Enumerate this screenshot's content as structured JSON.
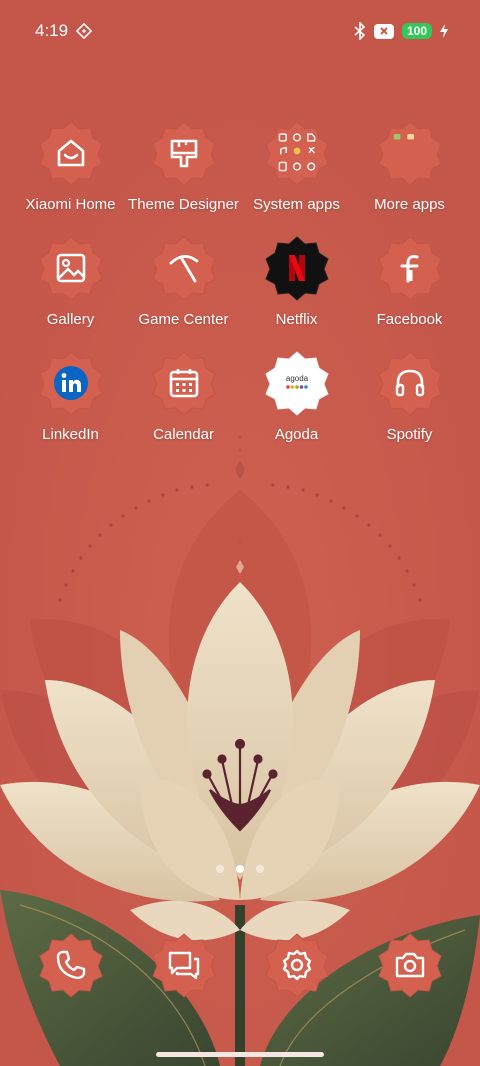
{
  "status_bar": {
    "time": "4:19",
    "battery": "100",
    "icons": [
      "sync-icon",
      "bluetooth-icon",
      "x-badge-icon",
      "charging-icon"
    ]
  },
  "apps": [
    {
      "label": "Xiaomi Home",
      "icon": "home-icon"
    },
    {
      "label": "Theme Designer",
      "icon": "brush-icon"
    },
    {
      "label": "System apps",
      "icon": "folder-icon"
    },
    {
      "label": "More apps",
      "icon": "folder-icon"
    },
    {
      "label": "Gallery",
      "icon": "gallery-icon"
    },
    {
      "label": "Game Center",
      "icon": "game-icon"
    },
    {
      "label": "Netflix",
      "icon": "netflix-icon"
    },
    {
      "label": "Facebook",
      "icon": "facebook-icon"
    },
    {
      "label": "LinkedIn",
      "icon": "linkedin-icon"
    },
    {
      "label": "Calendar",
      "icon": "calendar-icon"
    },
    {
      "label": "Agoda",
      "icon": "agoda-icon",
      "logo_text": "agoda"
    },
    {
      "label": "Spotify",
      "icon": "headphones-icon"
    }
  ],
  "dock": [
    {
      "icon": "phone-icon"
    },
    {
      "icon": "messages-icon"
    },
    {
      "icon": "settings-icon"
    },
    {
      "icon": "camera-icon"
    }
  ],
  "page_indicator": {
    "pages": 3,
    "active": 2
  },
  "colors": {
    "background": "#c9594a",
    "icon_tile": "#d2604f",
    "petal": "#e9d7bb",
    "leaf": "#4a5a3a",
    "battery": "#34c759"
  }
}
